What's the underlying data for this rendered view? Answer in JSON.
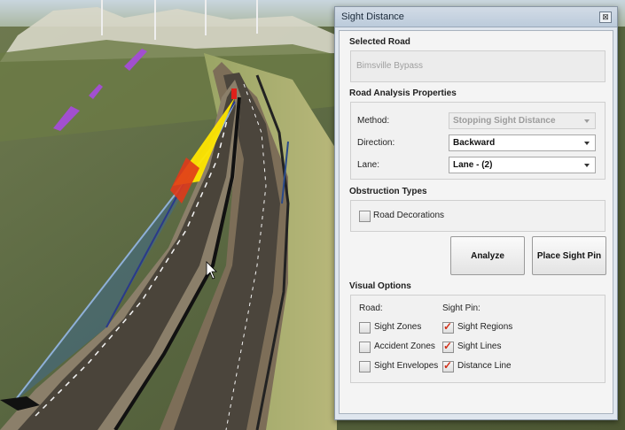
{
  "window": {
    "title": "Sight Distance",
    "close_glyph": "⊠"
  },
  "selected_road": {
    "heading": "Selected Road",
    "value": "Bimsville Bypass"
  },
  "road_analysis": {
    "heading": "Road Analysis Properties",
    "method": {
      "label": "Method:",
      "value": "Stopping Sight Distance",
      "disabled": true
    },
    "direction": {
      "label": "Direction:",
      "value": "Backward"
    },
    "lane": {
      "label": "Lane:",
      "value": "Lane - (2)"
    }
  },
  "obstruction": {
    "heading": "Obstruction Types",
    "road_decorations": {
      "label": "Road Decorations",
      "checked": false
    }
  },
  "buttons": {
    "analyze": "Analyze",
    "place_sight_pin": "Place Sight Pin"
  },
  "visual_options": {
    "heading": "Visual Options",
    "road_heading": "Road:",
    "sight_pin_heading": "Sight Pin:",
    "road": [
      {
        "label": "Sight Zones",
        "checked": false
      },
      {
        "label": "Accident Zones",
        "checked": false
      },
      {
        "label": "Sight Envelopes",
        "checked": false
      }
    ],
    "sight_pin": [
      {
        "label": "Sight Regions",
        "checked": true
      },
      {
        "label": "Sight Lines",
        "checked": true
      },
      {
        "label": "Distance Line",
        "checked": true
      }
    ]
  },
  "colors": {
    "accent_check": "#d0301a",
    "sight_line": "#ffe000",
    "pin": "#e0201a"
  }
}
